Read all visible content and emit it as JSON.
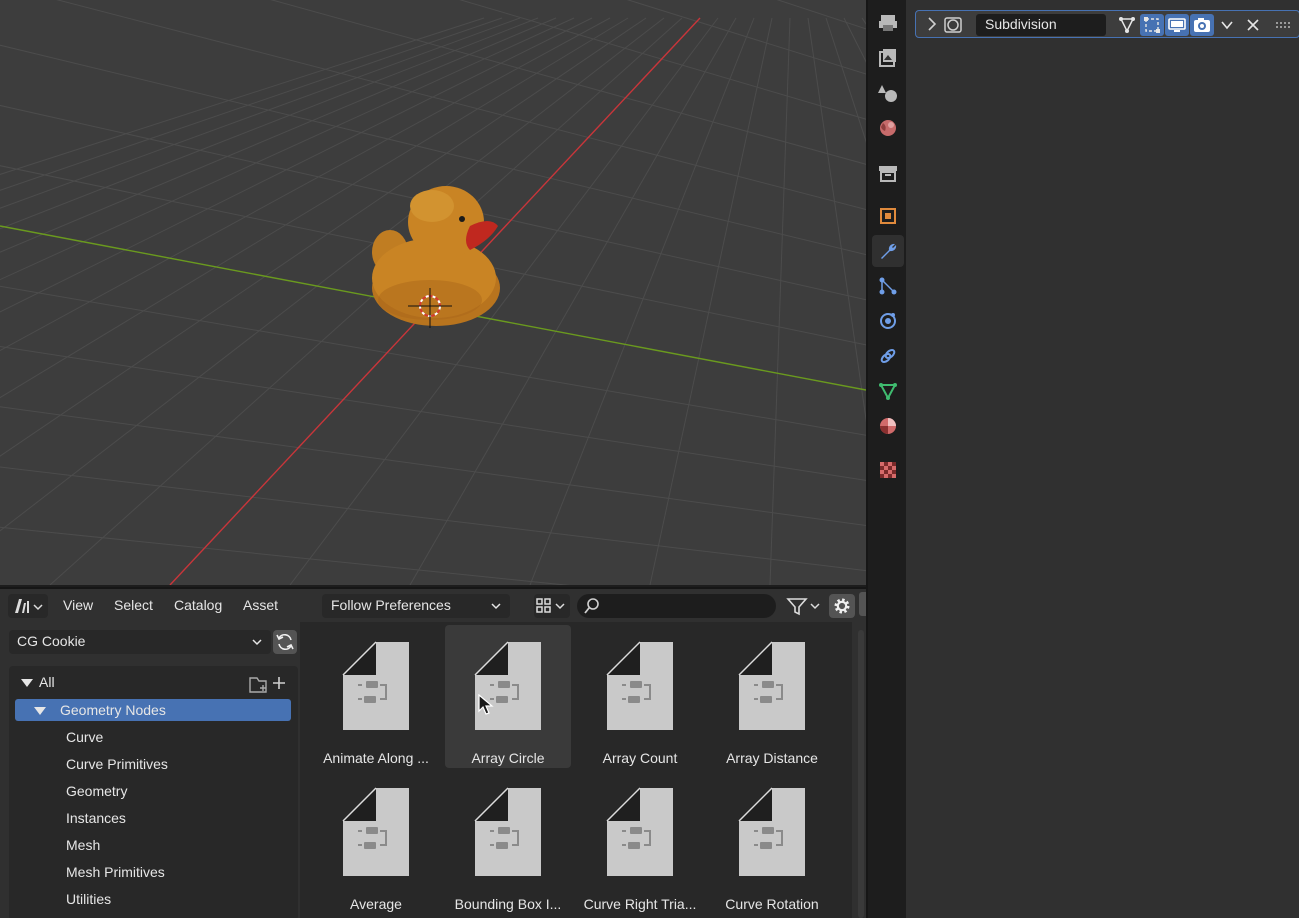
{
  "viewport": {
    "background": "#3d3d3d",
    "axis_x_color": "#c8353a",
    "axis_y_color": "#6a9a1e",
    "object": "duck"
  },
  "properties_tabs": [
    {
      "name": "tool-tab",
      "icon": "tool-icon"
    },
    {
      "name": "render-tab",
      "icon": "render-icon"
    },
    {
      "name": "output-tab",
      "icon": "output-icon"
    },
    {
      "name": "view-layer-tab",
      "icon": "view-layer-icon"
    },
    {
      "name": "scene-tab",
      "icon": "scene-icon"
    },
    {
      "name": "world-tab",
      "icon": "world-icon"
    },
    {
      "name": "collection-tab",
      "icon": "collection-icon"
    },
    {
      "name": "object-tab",
      "icon": "object-icon"
    },
    {
      "name": "modifiers-tab",
      "icon": "wrench-icon",
      "active": true
    },
    {
      "name": "particles-tab",
      "icon": "particles-icon"
    },
    {
      "name": "physics-tab",
      "icon": "physics-icon"
    },
    {
      "name": "constraints-tab",
      "icon": "constraints-icon"
    },
    {
      "name": "data-tab",
      "icon": "mesh-data-icon"
    },
    {
      "name": "material-tab",
      "icon": "material-icon"
    },
    {
      "name": "texture-tab",
      "icon": "texture-icon"
    }
  ],
  "modifier": {
    "name": "Subdivision",
    "accent": "#4772b3"
  },
  "asset_browser": {
    "menus": [
      "View",
      "Select",
      "Catalog",
      "Asset"
    ],
    "import_method": "Follow Preferences",
    "search_placeholder": "",
    "library": "CG Cookie",
    "catalogs": [
      {
        "label": "All",
        "level": 0,
        "expanded": true
      },
      {
        "label": "Geometry Nodes",
        "level": 1,
        "expanded": true,
        "selected": true
      },
      {
        "label": "Curve",
        "level": 2
      },
      {
        "label": "Curve Primitives",
        "level": 2
      },
      {
        "label": "Geometry",
        "level": 2
      },
      {
        "label": "Instances",
        "level": 2
      },
      {
        "label": "Mesh",
        "level": 2
      },
      {
        "label": "Mesh Primitives",
        "level": 2
      },
      {
        "label": "Utilities",
        "level": 2
      }
    ],
    "assets": [
      "Animate Along ...",
      "Array Circle",
      "Array Count",
      "Array Distance",
      "Average",
      "Bounding Box I...",
      "Curve Right Tria...",
      "Curve Rotation"
    ],
    "hovered_asset": "Array Circle"
  }
}
